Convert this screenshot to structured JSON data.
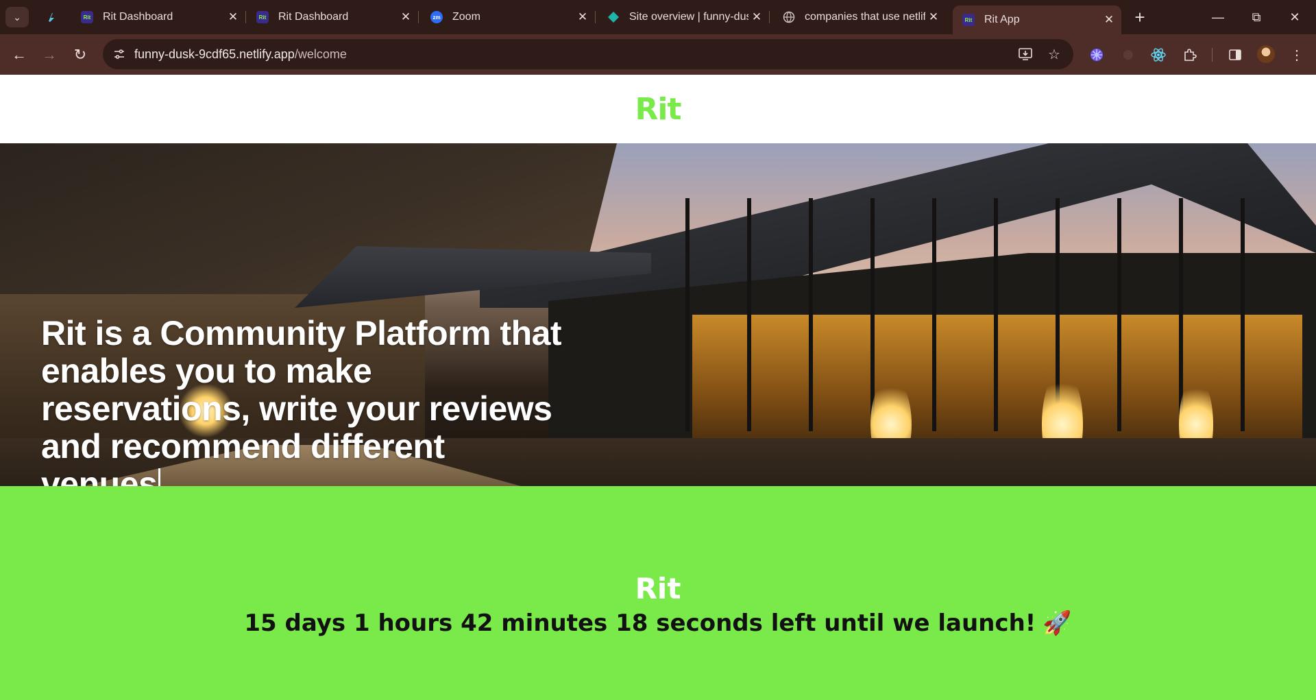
{
  "browser": {
    "tabs": [
      {
        "icon": "netlify-icon",
        "title": ""
      },
      {
        "icon": "rit-icon",
        "title": "Rit Dashboard"
      },
      {
        "icon": "rit-icon",
        "title": "Rit Dashboard"
      },
      {
        "icon": "zoom-icon",
        "title": "Zoom"
      },
      {
        "icon": "netlify-diamond-icon",
        "title": "Site overview | funny-dusk"
      },
      {
        "icon": "globe-icon",
        "title": "companies that use netlify"
      },
      {
        "icon": "rit-icon",
        "title": "Rit App",
        "active": true
      }
    ],
    "rit_favicon_text": "Rit",
    "zoom_favicon_text": "zm",
    "url_host": "funny-dusk-9cdf65.netlify.app",
    "url_path": "/welcome"
  },
  "site": {
    "header_logo": "Rit",
    "hero": {
      "line1": "Rit is a Community Platform that",
      "line2": "enables you to make",
      "line3": "reservations, write your reviews",
      "line4": "and recommend different venues"
    },
    "launch": {
      "logo": "Rit",
      "countdown": "15 days 1 hours 42 minutes 18 seconds left until we launch!",
      "rocket": "🚀"
    }
  },
  "colors": {
    "brand_green": "#7aea4b",
    "browser_frame": "#2f1b18",
    "toolbar": "#4e2d28"
  }
}
